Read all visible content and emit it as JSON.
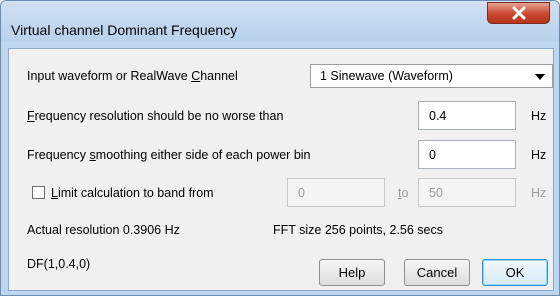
{
  "window": {
    "title": "Virtual channel Dominant Frequency",
    "close_symbol": "X"
  },
  "input": {
    "label_prefix": "Input waveform or RealWave ",
    "label_mnemonic": "C",
    "label_suffix": "hannel",
    "selected": "1 Sinewave (Waveform)"
  },
  "resolution": {
    "label_mnemonic": "F",
    "label_suffix": "requency resolution should be no worse than",
    "value": "0.4",
    "unit": "Hz"
  },
  "smoothing": {
    "label_prefix": "Frequency ",
    "label_mnemonic": "s",
    "label_suffix": "moothing either side of each  power bin",
    "value": "0",
    "unit": "Hz"
  },
  "band": {
    "checked": false,
    "label_mnemonic": "L",
    "label_suffix": "imit calculation to band from",
    "from_value": "0",
    "to_mnemonic": "t",
    "to_suffix": "o",
    "to_value": "50",
    "unit": "Hz"
  },
  "info": {
    "actual_resolution": "Actual resolution  0.3906 Hz",
    "fft_size": "FFT size  256 points, 2.56 secs",
    "formula": "DF(1,0.4,0)"
  },
  "buttons": {
    "help": "Help",
    "cancel": "Cancel",
    "ok": "OK"
  },
  "icons": {
    "close": "close-icon",
    "dropdown": "chevron-down-icon",
    "checkbox": "checkbox-unchecked"
  }
}
